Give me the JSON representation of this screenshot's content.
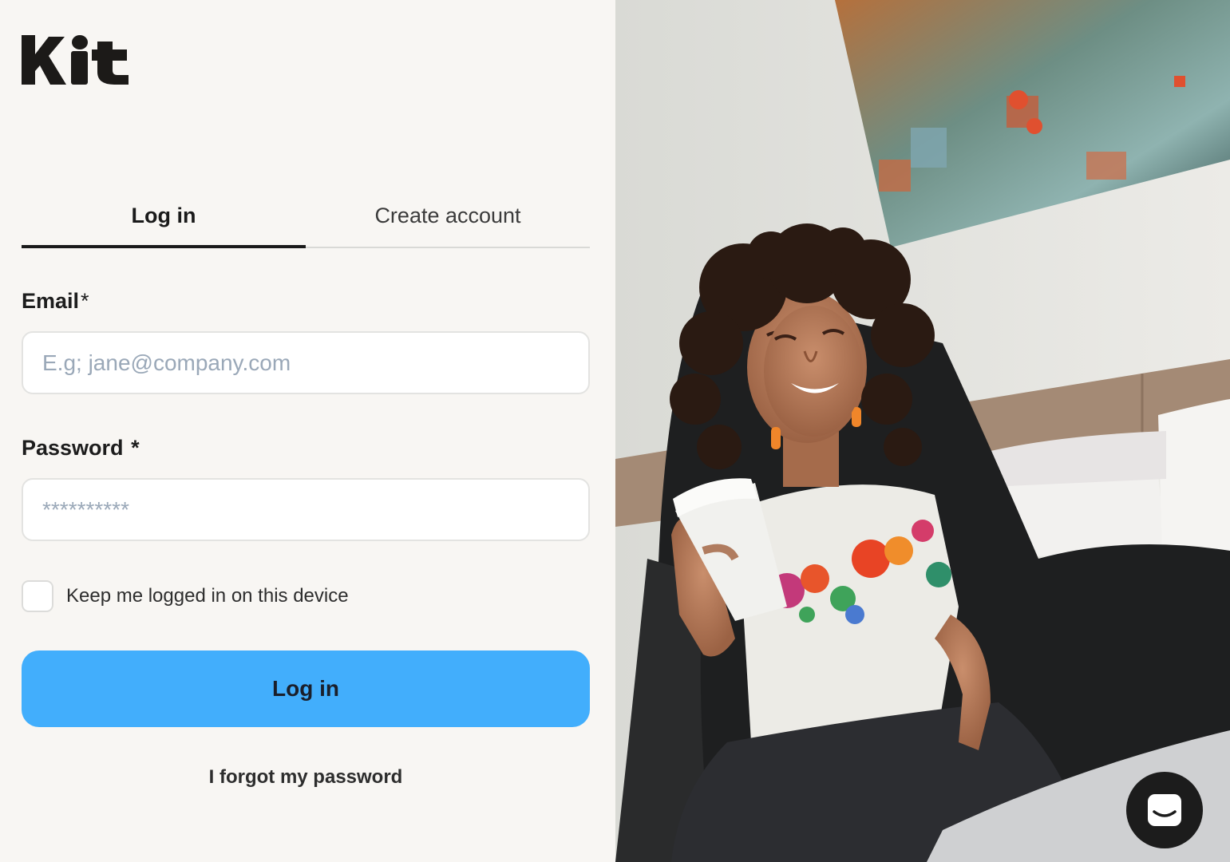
{
  "brand": {
    "logo_text": "Kit"
  },
  "tabs": [
    {
      "label": "Log in",
      "active": true
    },
    {
      "label": "Create account",
      "active": false
    }
  ],
  "form": {
    "email": {
      "label": "Email",
      "required_mark": "*",
      "placeholder": "E.g; jane@company.com",
      "value": ""
    },
    "password": {
      "label": "Password",
      "required_mark": "*",
      "placeholder": "**********",
      "value": ""
    },
    "keep_logged_in": {
      "label": "Keep me logged in on this device",
      "checked": false
    },
    "submit_label": "Log in",
    "forgot_label": "I forgot my password"
  },
  "colors": {
    "accent": "#42aefc",
    "left_background": "#f8f6f3",
    "text": "#1d1d1d"
  },
  "chat_widget": {
    "icon": "chat-bubble-icon"
  },
  "hero_image": {
    "description_icon": "photo-woman-with-coffee"
  }
}
